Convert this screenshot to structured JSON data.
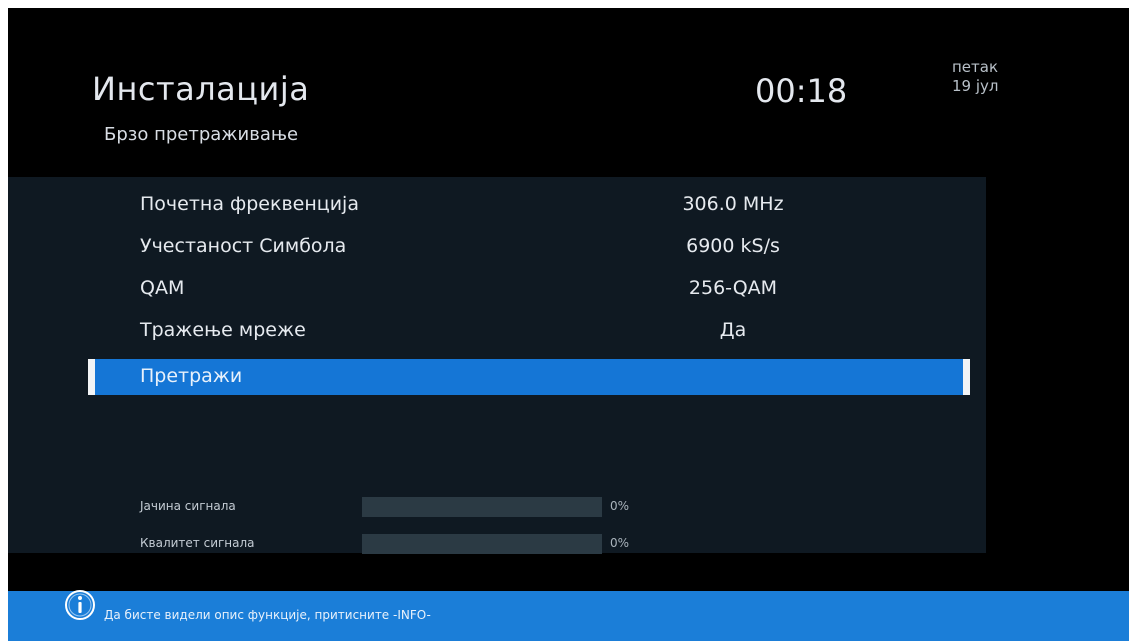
{
  "header": {
    "title": "Инсталација",
    "subtitle": "Брзо претраживање",
    "time": "00:18",
    "weekday": "петак",
    "date": "19 јул"
  },
  "menu": {
    "items": [
      {
        "label": "Почетна фреквенција",
        "value": "306.0 MHz"
      },
      {
        "label": "Учестаност Симбола",
        "value": "6900 kS/s"
      },
      {
        "label": "QAM",
        "value": "256-QAM"
      },
      {
        "label": "Тражење мреже",
        "value": "Да"
      },
      {
        "label": "Претражи",
        "value": "",
        "selected": true
      }
    ]
  },
  "signal": {
    "strength": {
      "label": "Јачина сигнала",
      "percent_text": "0%",
      "level": 0
    },
    "quality": {
      "label": "Квалитет сигнала",
      "percent_text": "0%",
      "level": 0
    }
  },
  "footer": {
    "icon": "info-icon",
    "hint": "Да бисте видели опис функције, притисните -INFO-"
  },
  "colors": {
    "background": "#000000",
    "panel": "#0f1922",
    "highlight": "#1576d6",
    "footer": "#1b7ed8",
    "bar_track": "#2b3a44"
  }
}
